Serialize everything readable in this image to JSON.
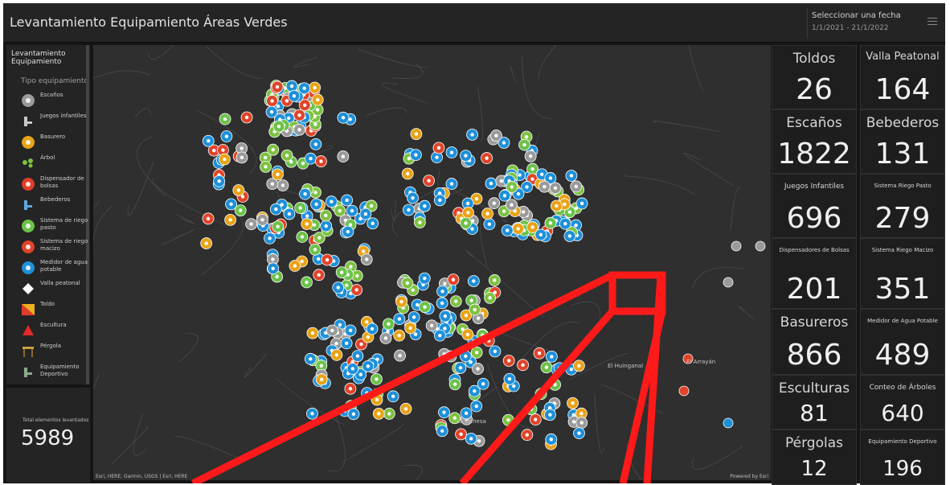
{
  "header": {
    "title": "Levantamiento Equipamiento Áreas Verdes",
    "date_label": "Seleccionar una fecha",
    "date_range": "1/1/2021 - 21/1/2022"
  },
  "legend": {
    "title": "Levantamiento Equipamiento",
    "subtitle": "Tipo equipamiento",
    "items": [
      {
        "label": "Escaños",
        "icon": "bench-icon",
        "color": "#9a9a9a"
      },
      {
        "label": "Juegos infantiles",
        "icon": "playground-icon",
        "color": "#c8c8c8"
      },
      {
        "label": "Basurero",
        "icon": "trash-can-icon",
        "color": "#e8a317"
      },
      {
        "label": "Árbol",
        "icon": "tree-icon",
        "color": "#7dc242"
      },
      {
        "label": "Dispensador de bolsas",
        "icon": "bag-dispenser-icon",
        "color": "#e03c2a"
      },
      {
        "label": "Bebederos",
        "icon": "drinking-fountain-icon",
        "color": "#5ea7e0"
      },
      {
        "label": "Sistema de riego pasto",
        "icon": "grass-irrigation-icon",
        "color": "#6cc24a"
      },
      {
        "label": "Sistema de riego macizo",
        "icon": "bed-irrigation-icon",
        "color": "#e0442a"
      },
      {
        "label": "Medidor de agua potable",
        "icon": "water-meter-icon",
        "color": "#1e90d8"
      },
      {
        "label": "Valla peatonal",
        "icon": "diamond-icon",
        "color": "#ffffff"
      },
      {
        "label": "Toldo",
        "icon": "awning-icon",
        "color": "#e8632a"
      },
      {
        "label": "Escultura",
        "icon": "sculpture-icon",
        "color": "#e02a2a"
      },
      {
        "label": "Pérgola",
        "icon": "pergola-icon",
        "color": "#c8a040"
      },
      {
        "label": "Equipamiento Deportivo",
        "icon": "sports-equipment-icon",
        "color": "#8aaa8a"
      }
    ]
  },
  "total": {
    "label": "Total elementos levantados",
    "value": "5989"
  },
  "map": {
    "attribution": "Esri, HERE, Garmin, USGS | Esri, HERE",
    "powered": "Powered by Esri",
    "places": [
      "El Huinganal",
      "El Arrayán",
      "La Dehesa"
    ]
  },
  "stats": [
    {
      "label": "Toldos",
      "value": "26"
    },
    {
      "label": "Valla Peatonal",
      "value": "164"
    },
    {
      "label": "Escaños",
      "value": "1822"
    },
    {
      "label": "Bebederos",
      "value": "131"
    },
    {
      "label": "Juegos Infantiles",
      "value": "696"
    },
    {
      "label": "Sistema Riego Pasto",
      "value": "279"
    },
    {
      "label": "Dispensadores de Bolsas",
      "value": "201"
    },
    {
      "label": "Sistema Riego Macizo",
      "value": "351"
    },
    {
      "label": "Basureros",
      "value": "866"
    },
    {
      "label": "Medidor de Agua Potable",
      "value": "489"
    },
    {
      "label": "Esculturas",
      "value": "81"
    },
    {
      "label": "Conteo de Árboles",
      "value": "640"
    },
    {
      "label": "Pérgolas",
      "value": "12"
    },
    {
      "label": "Equipamiento Deportivo",
      "value": "196"
    }
  ]
}
